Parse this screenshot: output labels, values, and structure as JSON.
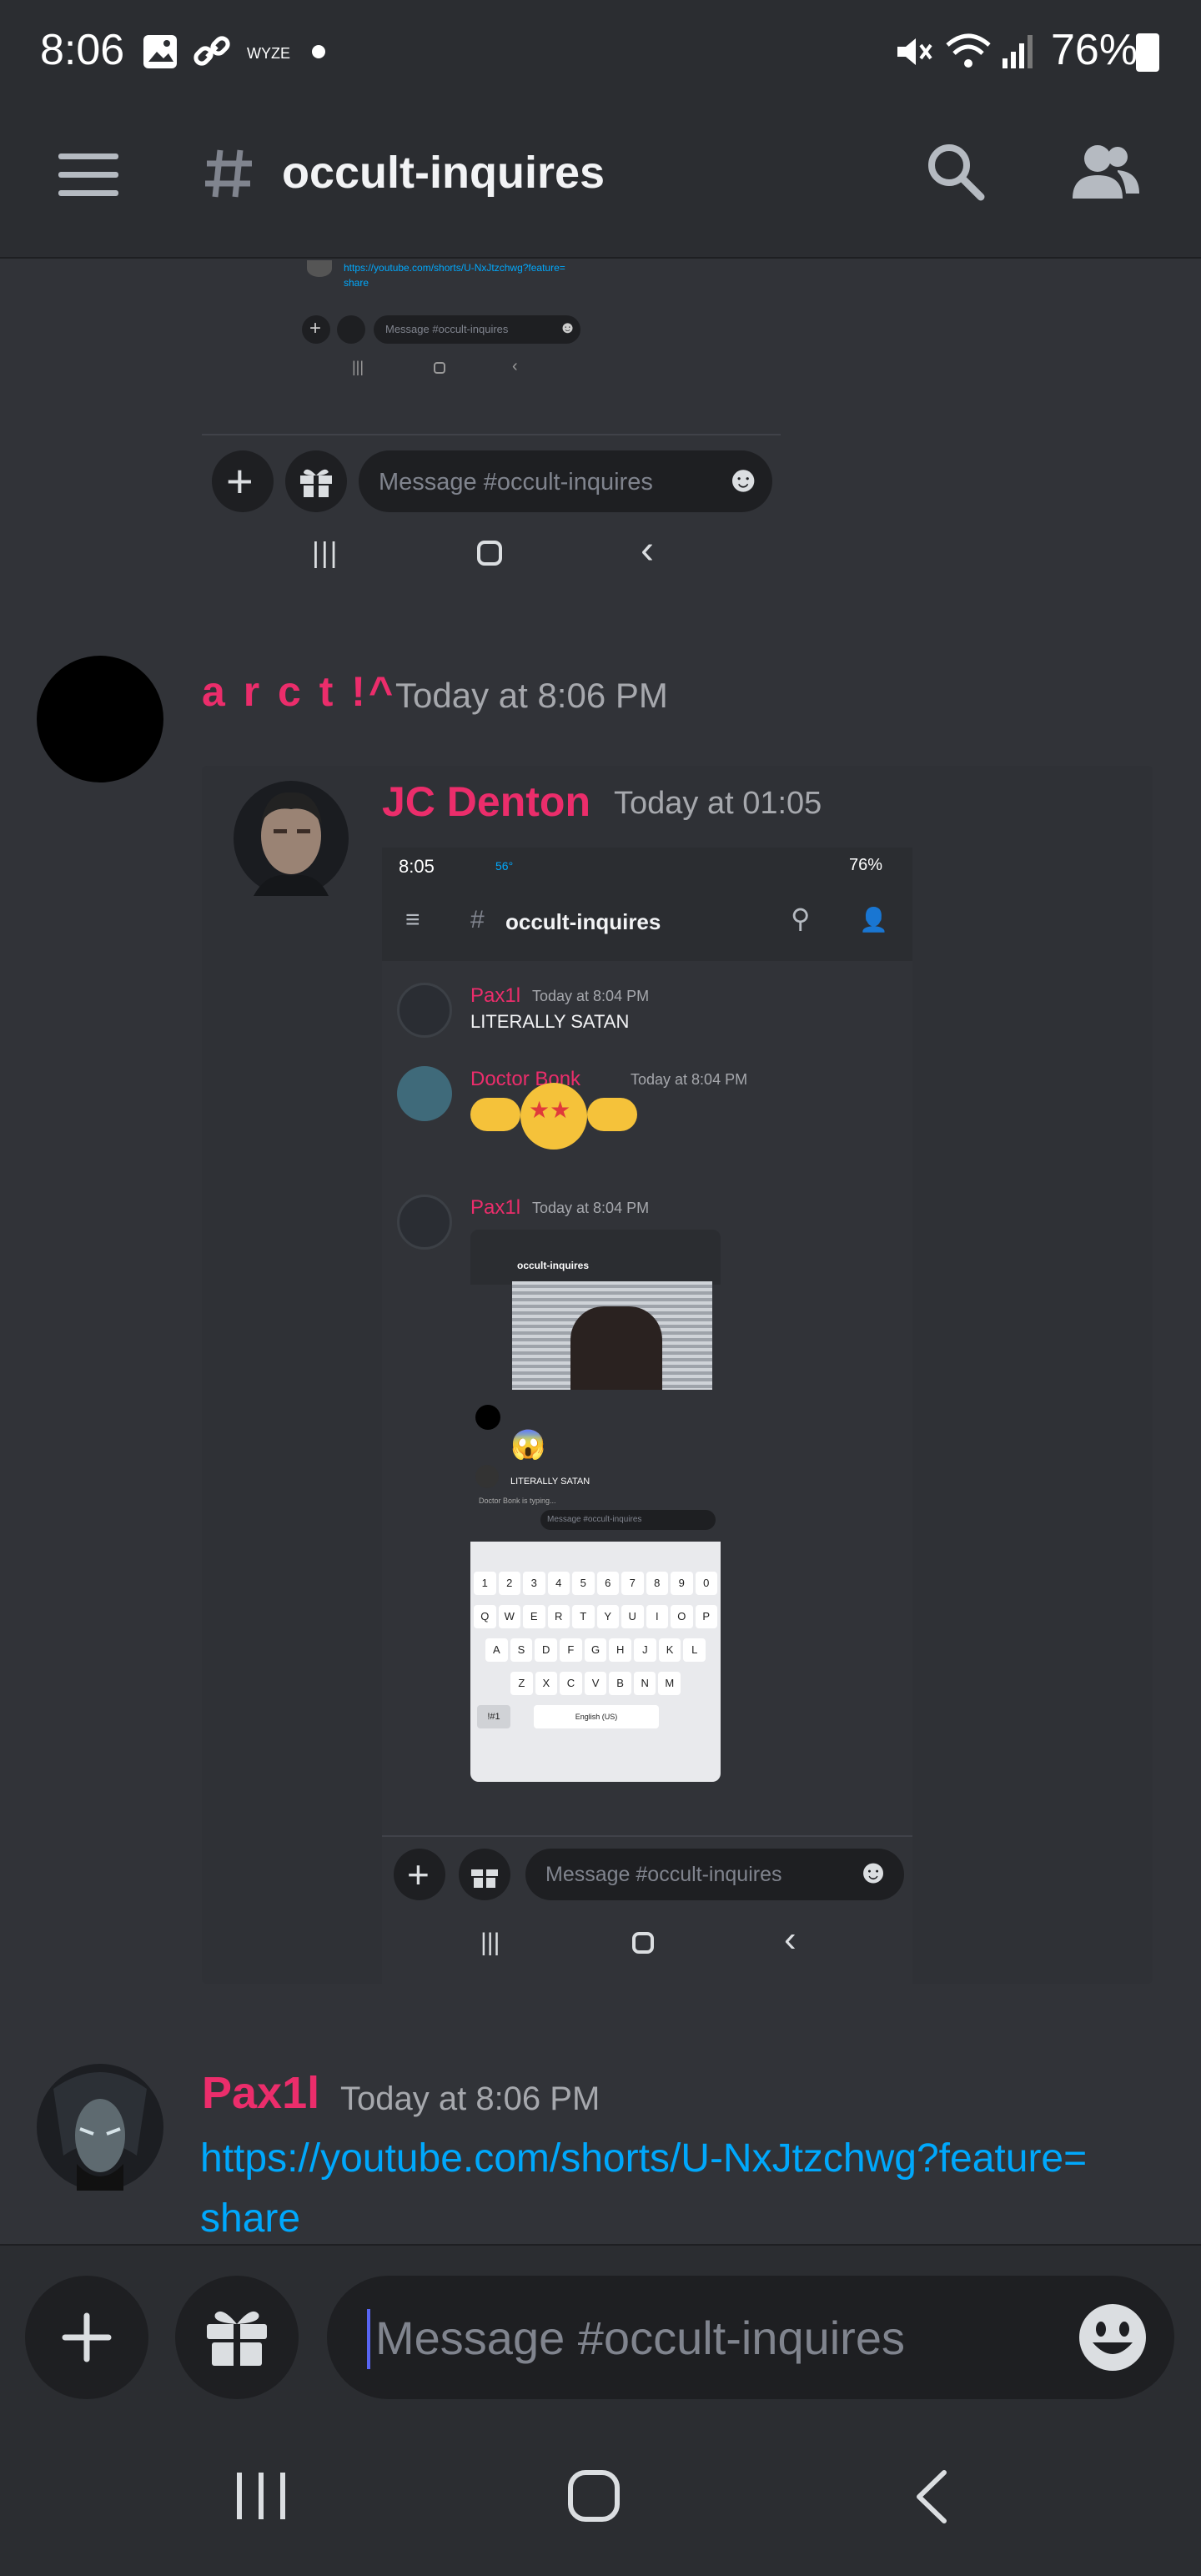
{
  "status_bar": {
    "time": "8:06",
    "app_label": "WYZE",
    "battery": "76%"
  },
  "header": {
    "channel": "occult-inquires"
  },
  "top_snippet": {
    "link_line1": "https://youtube.com/shorts/U-NxJtzchwg?feature=",
    "link_line2": "share",
    "small_placeholder": "Message #occult-inquires",
    "placeholder": "Message #occult-inquires"
  },
  "messages": [
    {
      "author": "a r c t !^",
      "time": "Today at 8:06 PM"
    },
    {
      "author": "Pax1l",
      "time": "Today at 8:06 PM",
      "link_line1": "https://youtube.com/shorts/U-NxJtzchwg?feature=",
      "link_line2": "share"
    }
  ],
  "forward": {
    "author": "JC Denton",
    "time": "Today at 01:05",
    "inner": {
      "status_time": "8:05",
      "status_temp": "56°",
      "status_battery": "76%",
      "channel": "occult-inquires",
      "msgs": [
        {
          "author": "Pax1l",
          "time": "Today at 8:04 PM",
          "text": "LITERALLY SATAN"
        },
        {
          "author": "Doctor Bonk",
          "time": "Today at 8:04 PM"
        },
        {
          "author": "Pax1l",
          "time": "Today at 8:04 PM"
        }
      ],
      "placeholder": "Message #occult-inquires",
      "deep": {
        "channel": "occult-inquires",
        "satan": "LITERALLY SATAN",
        "typing": "Doctor Bonk is typing...",
        "placeholder": "Message #occult-inquires",
        "keys_row1": [
          "1",
          "2",
          "3",
          "4",
          "5",
          "6",
          "7",
          "8",
          "9",
          "0"
        ],
        "keys_row2": [
          "Q",
          "W",
          "E",
          "R",
          "T",
          "Y",
          "U",
          "I",
          "O",
          "P"
        ],
        "keys_row3": [
          "A",
          "S",
          "D",
          "F",
          "G",
          "H",
          "J",
          "K",
          "L"
        ],
        "keys_row4": [
          "Z",
          "X",
          "C",
          "V",
          "B",
          "N",
          "M"
        ],
        "space_label": "English (US)",
        "sym_label": "!#1"
      }
    }
  },
  "composer": {
    "placeholder": "Message #occult-inquires"
  },
  "icons": {
    "menu": "hamburger-icon",
    "hash": "hash-icon",
    "search": "search-icon",
    "members": "members-icon",
    "add": "plus-icon",
    "gift": "gift-icon",
    "emoji": "emoji-icon"
  },
  "colors": {
    "background": "#313338",
    "bars": "#2b2d31",
    "username": "#eb2d6b",
    "link": "#00a8fc"
  }
}
